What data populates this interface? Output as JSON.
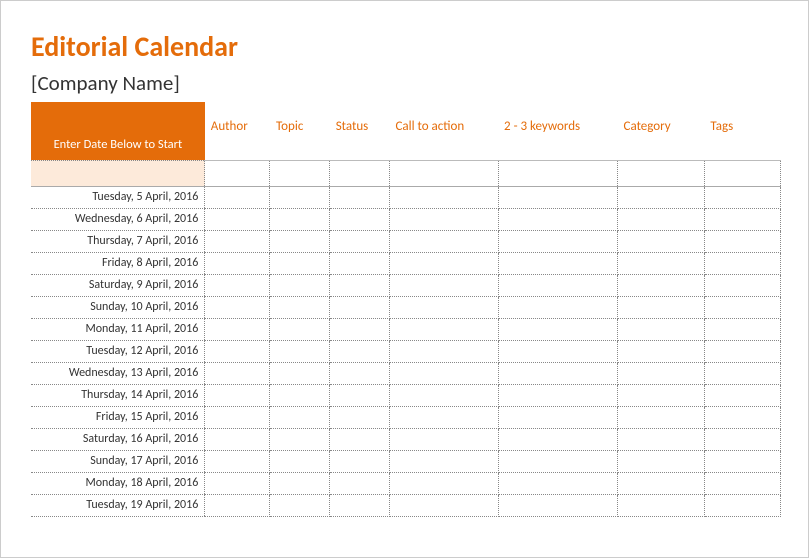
{
  "title": "Editorial Calendar",
  "company": "[Company Name]",
  "dateHeader": "Enter Date Below to Start",
  "columns": [
    "Author",
    "Topic",
    "Status",
    "Call to action",
    "2 - 3 keywords",
    "Category",
    "Tags"
  ],
  "rows": [
    "Tuesday, 5 April, 2016",
    "Wednesday, 6 April, 2016",
    "Thursday, 7 April, 2016",
    "Friday, 8 April, 2016",
    "Saturday, 9 April, 2016",
    "Sunday, 10 April, 2016",
    "Monday, 11 April, 2016",
    "Tuesday, 12 April, 2016",
    "Wednesday, 13 April, 2016",
    "Thursday, 14 April, 2016",
    "Friday, 15 April, 2016",
    "Saturday, 16 April, 2016",
    "Sunday, 17 April, 2016",
    "Monday, 18 April, 2016",
    "Tuesday, 19 April, 2016"
  ],
  "colors": {
    "accent": "#E46C0A",
    "tint": "#FDEADA"
  }
}
